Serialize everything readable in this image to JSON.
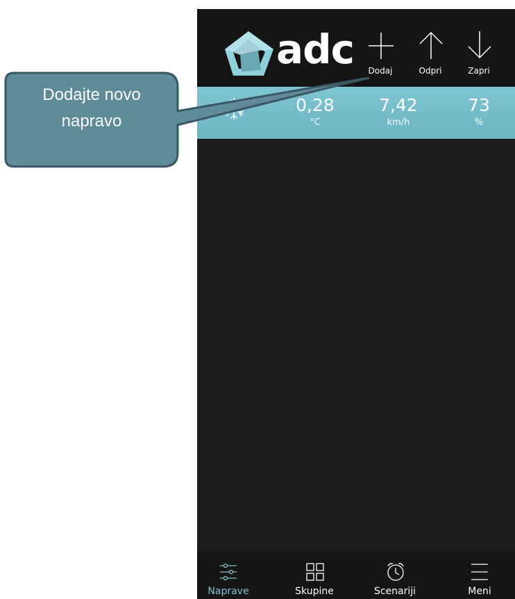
{
  "header": {
    "logo_text": "adc",
    "actions": [
      {
        "label": "Dodaj",
        "icon": "plus-icon"
      },
      {
        "label": "Odpri",
        "icon": "arrow-up-icon"
      },
      {
        "label": "Zapri",
        "icon": "arrow-down-icon"
      }
    ]
  },
  "weather": {
    "icon": "snowflake-icon",
    "temperature": {
      "value": "0,28",
      "unit": "°C"
    },
    "wind": {
      "value": "7,42",
      "unit": "km/h"
    },
    "humidity": {
      "value": "73",
      "unit": "%"
    }
  },
  "bottom_nav": [
    {
      "label": "Naprave",
      "icon": "sliders-icon",
      "active": true
    },
    {
      "label": "Skupine",
      "icon": "grid-icon",
      "active": false
    },
    {
      "label": "Scenariji",
      "icon": "alarm-clock-icon",
      "active": false
    },
    {
      "label": "Meni",
      "icon": "hamburger-menu-icon",
      "active": false
    }
  ],
  "callout": {
    "line1": "Dodajte novo",
    "line2": "napravo"
  },
  "colors": {
    "accent": "#7fc4d1",
    "background": "#1b1b1b",
    "callout_fill": "#5f8a97",
    "callout_border": "#3a5761"
  }
}
